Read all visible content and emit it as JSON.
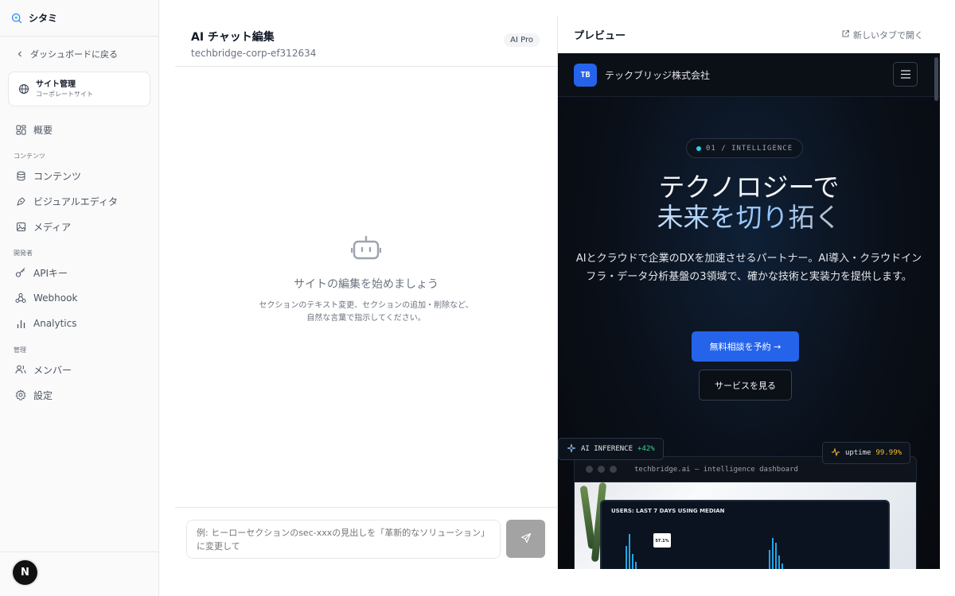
{
  "brand": {
    "name": "シタミ"
  },
  "sidebar": {
    "back_label": "ダッシュボードに戻る",
    "site_card": {
      "title": "サイト管理",
      "subtitle": "コーポレートサイト"
    },
    "overview": "概要",
    "sections": {
      "content": "コンテンツ",
      "developer": "開発者",
      "admin": "管理"
    },
    "content_items": [
      {
        "label": "コンテンツ",
        "icon": "database-icon"
      },
      {
        "label": "ビジュアルエディタ",
        "icon": "pen-tool-icon"
      },
      {
        "label": "メディア",
        "icon": "image-icon"
      }
    ],
    "developer_items": [
      {
        "label": "APIキー",
        "icon": "key-icon"
      },
      {
        "label": "Webhook",
        "icon": "webhook-icon"
      },
      {
        "label": "Analytics",
        "icon": "bar-chart-icon"
      }
    ],
    "admin_items": [
      {
        "label": "メンバー",
        "icon": "users-icon"
      },
      {
        "label": "設定",
        "icon": "gear-icon"
      }
    ],
    "footer_badge": "N"
  },
  "chat": {
    "title": "AI チャット編集",
    "subtitle": "techbridge-corp-ef312634",
    "plan_badge": "AI Pro",
    "empty_title": "サイトの編集を始めましょう",
    "empty_desc_line1": "セクションのテキスト変更、セクションの追加・削除など、",
    "empty_desc_line2": "自然な言葉で指示してください。",
    "input_placeholder": "例: ヒーローセクションのsec-xxxの見出しを「革新的なソリューション」に変更して"
  },
  "preview": {
    "title": "プレビュー",
    "open_new_tab": "新しいタブで開く",
    "site": {
      "logo": "TB",
      "company": "テックブリッジ株式会社",
      "pill": "01 / INTELLIGENCE",
      "headline_line1": "テクノロジーで",
      "headline_line2": "未来を切り拓く",
      "body": "AIとクラウドで企業のDXを加速させるパートナー。AI導入・クラウドインフラ・データ分析基盤の3領域で、確かな技術と実装力を提供します。",
      "cta_primary": "無料相談を予約 →",
      "cta_secondary": "サービスを見る",
      "float_inference": "AI INFERENCE",
      "float_inference_delta": "+42%",
      "float_uptime": "uptime",
      "float_uptime_value": "99.99%",
      "dashboard_url": "techbridge.ai — intelligence dashboard",
      "dashboard_heading": "USERS: LAST 7 DAYS USING MEDIAN",
      "dashboard_tooltip": "57.1%"
    }
  },
  "colors": {
    "accent": "#2563eb",
    "site_bg": "#0a0f18",
    "send_button": "#a3a3a3"
  }
}
